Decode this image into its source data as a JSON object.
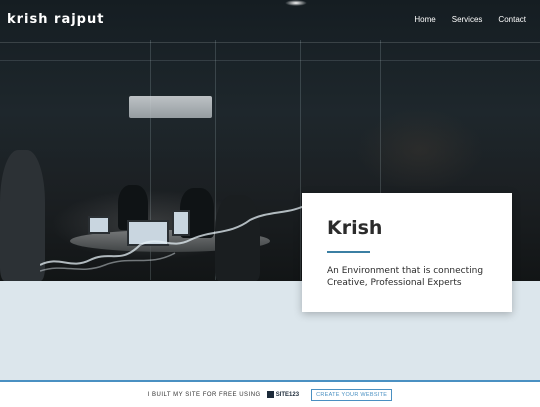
{
  "site": {
    "brand": "krish rajput"
  },
  "nav": {
    "items": [
      {
        "label": "Home"
      },
      {
        "label": "Services"
      },
      {
        "label": "Contact"
      }
    ]
  },
  "hero_card": {
    "title": "Krish",
    "subtitle": "An Environment that is connecting Creative, Professional Experts",
    "accent_color": "#3b7fa3"
  },
  "footer_banner": {
    "text": "I BUILT MY SITE FOR FREE USING",
    "logo_text": "SITE123",
    "cta_label": "CREATE YOUR WEBSITE",
    "accent_color": "#4a90c2"
  }
}
